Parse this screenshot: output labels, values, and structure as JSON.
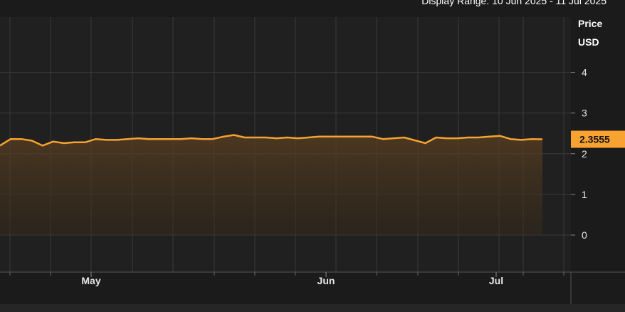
{
  "header": {
    "display_range_label": "Display Range: 10 Jun 2025 - 11 Jul 2025"
  },
  "colors": {
    "background": "#1b1b1b",
    "plot_background": "#202020",
    "grid": "#3a3a3a",
    "line": "#f7a231",
    "badge_bg": "#f7a231",
    "badge_text": "#111111"
  },
  "chart_data": {
    "type": "area",
    "title": "",
    "xlabel": "",
    "ylabel": "Price USD",
    "ylabel_lines": [
      "Price",
      "USD"
    ],
    "ylim": [
      -0.8,
      5.5
    ],
    "y_ticks": [
      0,
      1,
      2,
      3,
      4
    ],
    "x_tick_labels": [
      "May",
      "Jun",
      "Jul"
    ],
    "grid": true,
    "last_value_label": "2.3555",
    "series": [
      {
        "values": [
          2.2,
          2.36,
          2.36,
          2.32,
          2.2,
          2.3,
          2.26,
          2.28,
          2.28,
          2.36,
          2.34,
          2.34,
          2.36,
          2.38,
          2.36,
          2.36,
          2.36,
          2.36,
          2.38,
          2.36,
          2.36,
          2.42,
          2.46,
          2.4,
          2.4,
          2.4,
          2.38,
          2.4,
          2.38,
          2.4,
          2.42,
          2.42,
          2.42,
          2.42,
          2.42,
          2.42,
          2.36,
          2.38,
          2.4,
          2.33,
          2.26,
          2.4,
          2.38,
          2.38,
          2.4,
          2.4,
          2.42,
          2.44,
          2.36,
          2.34,
          2.36,
          2.3555
        ]
      }
    ]
  }
}
